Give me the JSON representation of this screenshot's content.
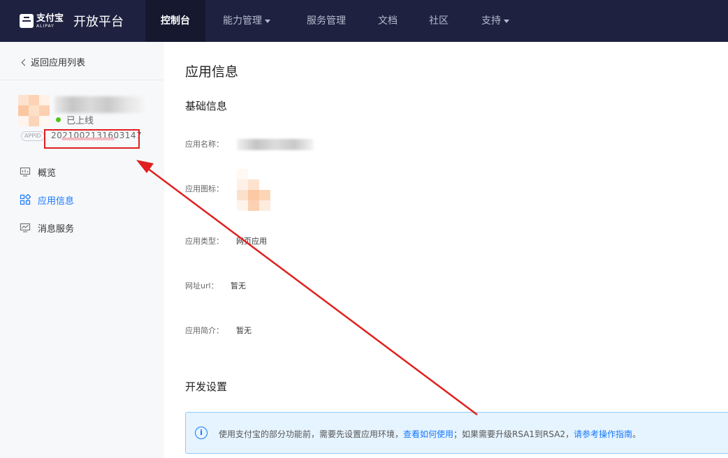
{
  "nav": {
    "brand_cn": "支付宝",
    "brand_en": "ALIPAY",
    "brand_title": "开放平台",
    "items": [
      {
        "label": "控制台",
        "active": true,
        "has_caret": false
      },
      {
        "label": "能力管理",
        "active": false,
        "has_caret": true
      },
      {
        "label": "服务管理",
        "active": false,
        "has_caret": false
      },
      {
        "label": "文档",
        "active": false,
        "has_caret": false
      },
      {
        "label": "社区",
        "active": false,
        "has_caret": false
      },
      {
        "label": "支持",
        "active": false,
        "has_caret": true
      }
    ]
  },
  "sidebar": {
    "back_label": "返回应用列表",
    "app": {
      "status": "已上线",
      "appid_tag": "APPID",
      "appid_value": "2021002131603147"
    },
    "menu": [
      {
        "label": "概览",
        "icon": "monitor-icon",
        "active": false
      },
      {
        "label": "应用信息",
        "icon": "grid-apps-icon",
        "active": true
      },
      {
        "label": "消息服务",
        "icon": "message-monitor-icon",
        "active": false
      }
    ]
  },
  "main": {
    "page_title": "应用信息",
    "basic_title": "基础信息",
    "fields": {
      "name_label": "应用名称：",
      "icon_label": "应用图标：",
      "type_label": "应用类型：",
      "type_value": "网页应用",
      "url_label": "网址url：",
      "url_value": "暂无",
      "desc_label": "应用简介：",
      "desc_value": "暂无"
    },
    "dev_title": "开发设置",
    "info_bar": {
      "text1": "使用支付宝的部分功能前，需要先设置应用环境，",
      "link1": "查看如何使用",
      "text2": "；如果需要升级RSA1到RSA2，",
      "link2": "请参考操作指南",
      "text3": "。"
    }
  },
  "colors": {
    "nav_bg": "#1e2240",
    "accent": "#1677ff",
    "online": "#52c41a",
    "annotation": "#e02020"
  }
}
